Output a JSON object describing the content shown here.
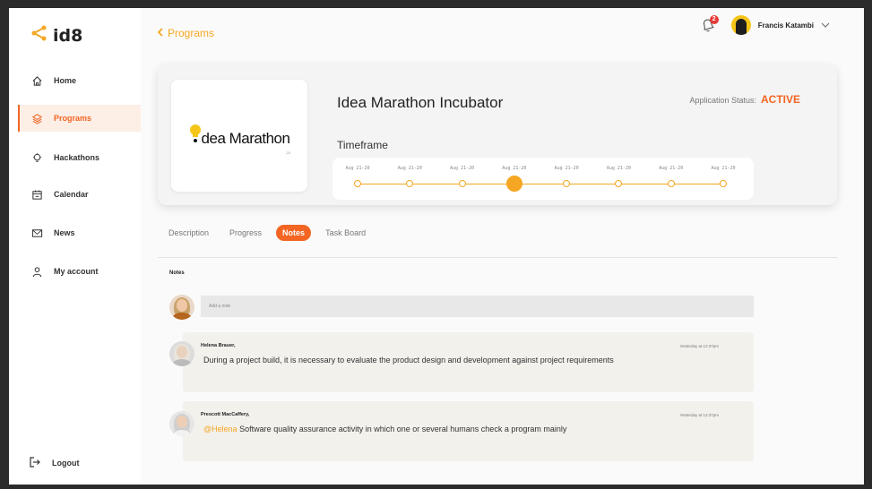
{
  "app": {
    "logo_text": "id8"
  },
  "sidebar": {
    "items": [
      {
        "label": "Home",
        "icon": "home-icon"
      },
      {
        "label": "Programs",
        "icon": "layers-icon",
        "active": true
      },
      {
        "label": "Hackathons",
        "icon": "bulb-icon"
      },
      {
        "label": "Calendar",
        "icon": "calendar-icon"
      },
      {
        "label": "News",
        "icon": "mail-icon"
      },
      {
        "label": "My account",
        "icon": "user-icon"
      }
    ],
    "logout_label": "Logout"
  },
  "header": {
    "back_label": "Programs",
    "notification_count": "2",
    "user_name": "Francis Katambi"
  },
  "program": {
    "title": "Idea Marathon Incubator",
    "logo_text": "dea Marathon",
    "logo_sub": "2.0",
    "status_label": "Application Status:",
    "status_value": "ACTIVE",
    "timeframe_label": "Timeframe",
    "timeline": {
      "dates": [
        "Aug 21-20",
        "Aug 21-20",
        "Aug 21-20",
        "Aug 21-20",
        "Aug 21-20",
        "Aug 21-20",
        "Aug 21-20",
        "Aug 21-20"
      ],
      "current_index": 3
    }
  },
  "tabs": [
    {
      "label": "Description"
    },
    {
      "label": "Progress"
    },
    {
      "label": "Notes",
      "active": true
    },
    {
      "label": "Task Board"
    }
  ],
  "notes": {
    "heading": "Notes",
    "input_placeholder": "Add a note",
    "items": [
      {
        "author": "Helena Brauer,",
        "time": "Yesterday at 12:37pm",
        "mention": "",
        "text": "During a project build, it is necessary to evaluate the product design and development against project requirements"
      },
      {
        "author": "Prescott MacCaffery,",
        "time": "Yesterday at 12:37pm",
        "mention": "@Helena",
        "text": " Software quality assurance activity in which one or several humans check a program mainly"
      }
    ]
  },
  "colors": {
    "accent": "#f26522",
    "highlight": "#f5a623",
    "active_nav_bg": "#fdeee6"
  }
}
